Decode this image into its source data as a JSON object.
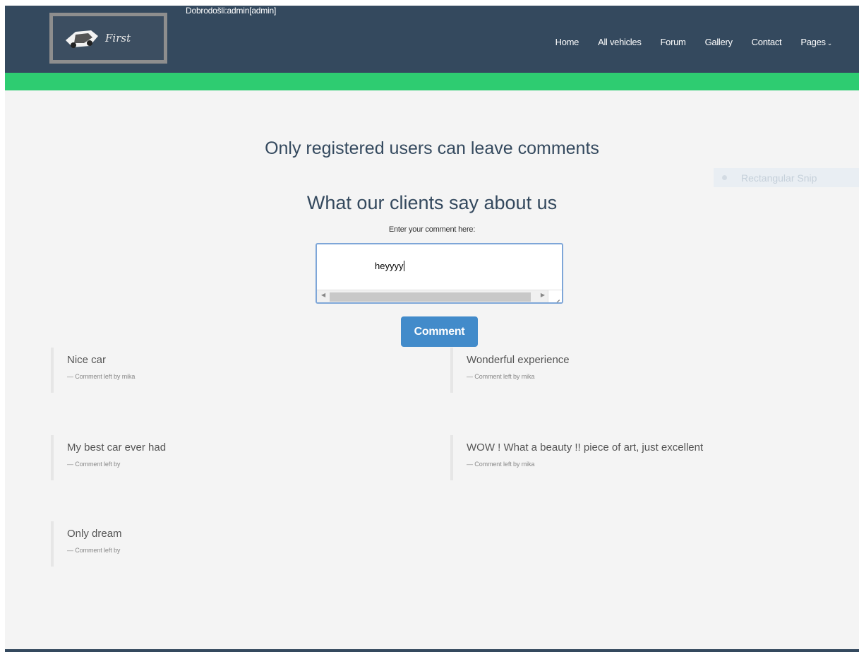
{
  "header": {
    "greeting": "Dobrodošli:admin[admin]",
    "logo_text": "First",
    "nav": [
      {
        "label": "Home"
      },
      {
        "label": "All vehicles"
      },
      {
        "label": "Forum"
      },
      {
        "label": "Gallery"
      },
      {
        "label": "Contact"
      },
      {
        "label": "Pages"
      }
    ]
  },
  "main": {
    "notice": "Only registered users can leave comments",
    "section_title": "What our clients say about us",
    "input_label": "Enter your comment here:",
    "comment_value": "heyyyy",
    "submit_label": "Comment"
  },
  "overlay": {
    "snip_label": "Rectangular Snip"
  },
  "comments": [
    {
      "text": "Nice car",
      "by": "— Comment left by mika"
    },
    {
      "text": "Wonderful experience",
      "by": "— Comment left by mika"
    },
    {
      "text": "My best car ever had",
      "by": "— Comment left by"
    },
    {
      "text": "WOW ! What a beauty !! piece of art, just excellent",
      "by": "— Comment left by mika"
    },
    {
      "text": "Only dream",
      "by": "— Comment left by"
    }
  ],
  "colors": {
    "header_bg": "#34495e",
    "accent_green": "#2ecc71",
    "button_blue": "#428bca"
  }
}
